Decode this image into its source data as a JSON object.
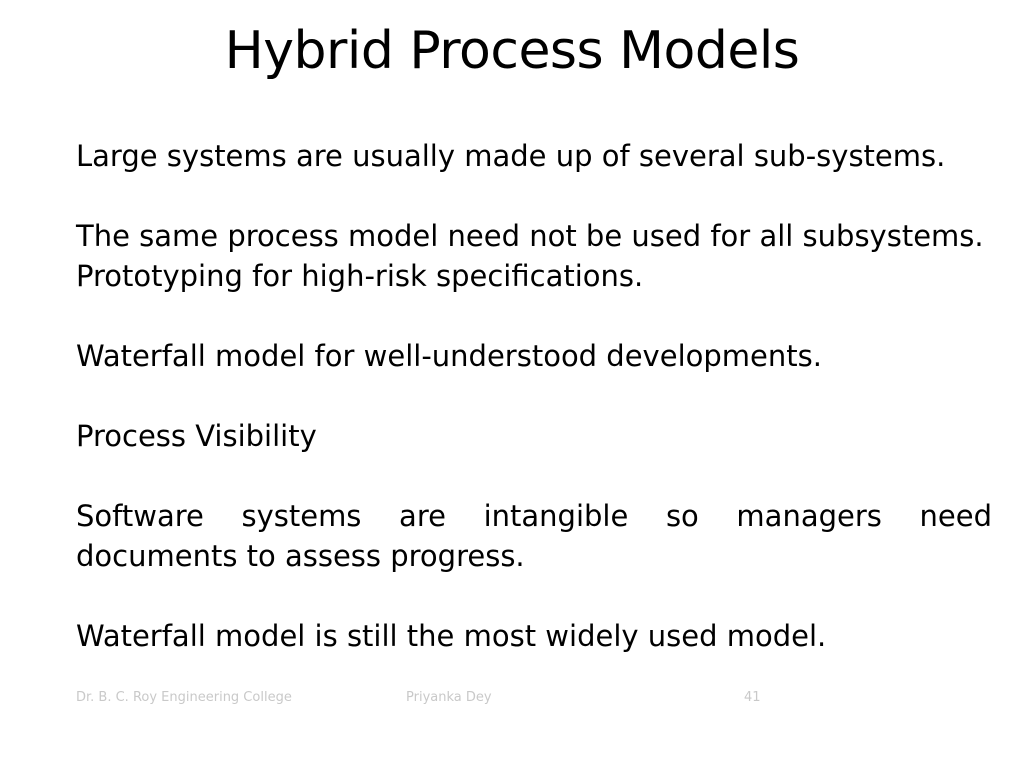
{
  "slide": {
    "title": "Hybrid Process Models",
    "paragraphs": [
      "Large systems are usually made up of several sub-systems.",
      "The same process model need not be used for all subsystems.",
      "Prototyping for high-risk specifications.",
      "Waterfall model for well-understood developments.",
      "Process Visibility",
      "Software systems are intangible so managers need documents to assess progress.",
      "Waterfall model is still the most widely used model."
    ]
  },
  "footer": {
    "institution": "Dr. B. C. Roy Engineering College",
    "author": "Priyanka Dey",
    "slide_number": "41"
  },
  "colors": {
    "background": "#ffffff",
    "text": "#000000",
    "footer_text": "#c9c9c9"
  }
}
